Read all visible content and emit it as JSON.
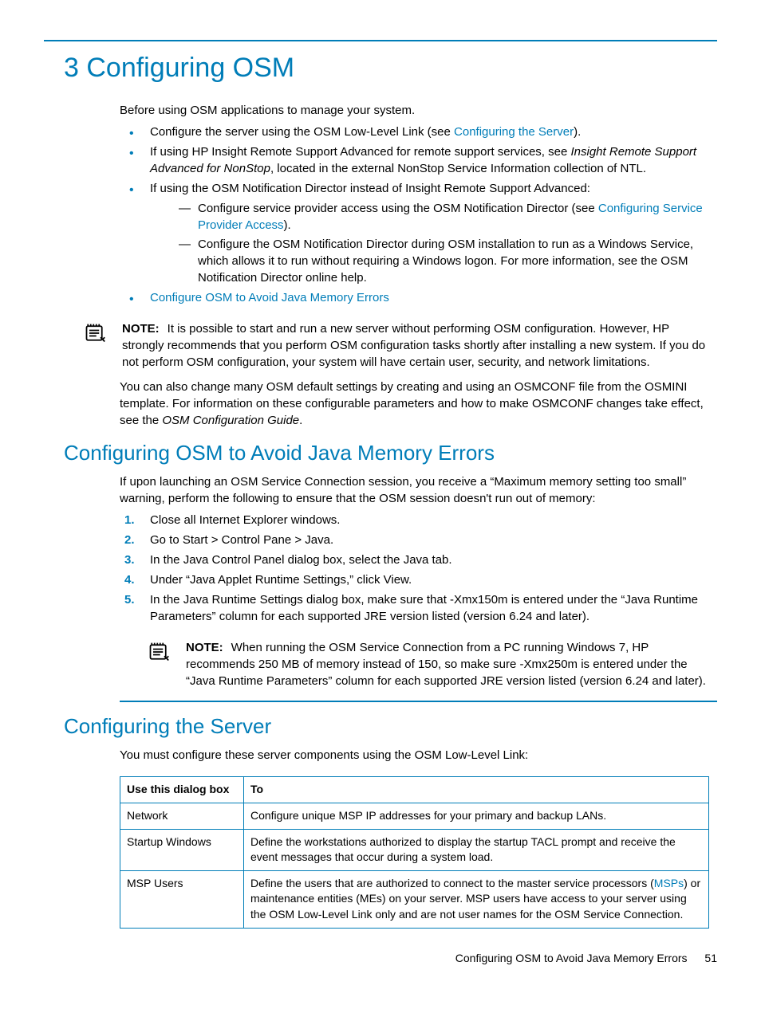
{
  "chapter": {
    "title": "3 Configuring OSM"
  },
  "intro": "Before using OSM applications to manage your system.",
  "bullets": {
    "b1_pre": "Configure the server using the OSM Low-Level Link (see ",
    "b1_link": "Configuring the Server",
    "b1_post": ").",
    "b2_pre": "If using HP Insight Remote Support Advanced for remote support services, see ",
    "b2_italic": "Insight Remote Support Advanced for NonStop",
    "b2_post": ", located in the external NonStop Service Information collection of NTL.",
    "b3": "If using the OSM Notification Director instead of Insight Remote Support Advanced:",
    "b3d1_pre": "Configure service provider access using the OSM Notification Director (see ",
    "b3d1_link": "Configuring Service Provider Access",
    "b3d1_post": ").",
    "b3d2": "Configure the OSM Notification Director during OSM installation to run as a Windows Service, which allows it to run without requiring a Windows logon. For more information, see the OSM Notification Director online help.",
    "b4_link": "Configure OSM to Avoid Java Memory Errors"
  },
  "note1": {
    "label": "NOTE:",
    "text": "It is possible to start and run a new server without performing OSM configuration. However, HP strongly recommends that you perform OSM configuration tasks shortly after installing a new system. If you do not perform OSM configuration, your system will have certain user, security, and network limitations."
  },
  "para2_pre": "You can also change many OSM default settings by creating and using an OSMCONF file from the OSMINI template. For information on these configurable parameters and how to make OSMCONF changes take effect, see the ",
  "para2_italic": "OSM Configuration Guide",
  "para2_post": ".",
  "sec1": {
    "title": "Configuring OSM to Avoid Java Memory Errors",
    "intro": "If upon launching an OSM Service Connection session, you receive a “Maximum memory setting too small” warning, perform the following to ensure that the OSM session doesn't run out of memory:",
    "steps": {
      "s1": "Close all Internet Explorer windows.",
      "s2": "Go to Start > Control Pane > Java.",
      "s3": "In the Java Control Panel dialog box, select the Java tab.",
      "s4": "Under “Java Applet Runtime Settings,” click View.",
      "s5": "In the Java Runtime Settings dialog box, make sure that -Xmx150m is entered under the “Java Runtime Parameters” column for each supported JRE version listed (version 6.24 and later)."
    }
  },
  "note2": {
    "label": "NOTE:",
    "text": "When running the OSM Service Connection from a PC running Windows 7, HP recommends 250 MB of memory instead of 150, so make sure -Xmx250m is entered under the “Java Runtime Parameters” column for each supported JRE version listed (version 6.24 and later)."
  },
  "sec2": {
    "title": "Configuring the Server",
    "intro": "You must configure these server components using the OSM Low-Level Link:",
    "table": {
      "h1": "Use this dialog box",
      "h2": "To",
      "r1c1": "Network",
      "r1c2": "Configure unique MSP IP addresses for your primary and backup LANs.",
      "r2c1": "Startup Windows",
      "r2c2": "Define the workstations authorized to display the startup TACL prompt and receive the event messages that occur during a system load.",
      "r3c1": "MSP Users",
      "r3c2_pre": "Define the users that are authorized to connect to the master service processors (",
      "r3c2_link": "MSPs",
      "r3c2_post": ") or maintenance entities (MEs) on your server. MSP users have access to your server using the OSM Low-Level Link only and are not user names for the OSM Service Connection."
    }
  },
  "footer": {
    "text": "Configuring OSM to Avoid Java Memory Errors",
    "page": "51"
  }
}
